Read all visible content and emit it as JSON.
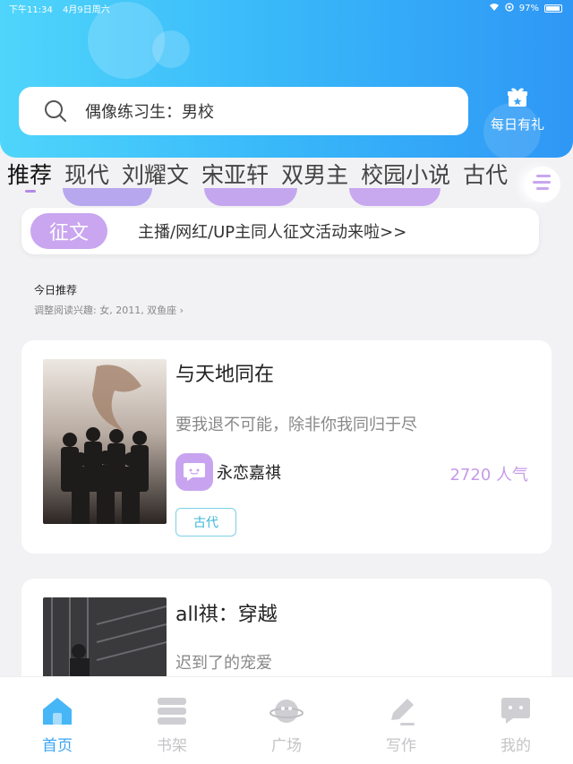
{
  "status_bar": {
    "time": "下午11:34",
    "date": "4月9日周六",
    "battery": "97%"
  },
  "search": {
    "placeholder": "偶像练习生：男校"
  },
  "gift": {
    "label": "每日有礼"
  },
  "tabs": [
    "推荐",
    "现代",
    "刘耀文",
    "宋亚轩",
    "双男主",
    "校园小说",
    "古代"
  ],
  "active_tab": "推荐",
  "notice": {
    "badge": "征文",
    "text": "主播/网红/UP主同人征文活动来啦>>"
  },
  "section": {
    "title": "今日推荐",
    "subtitle": "调整阅读兴趣: 女, 2011, 双鱼座 ›"
  },
  "books": [
    {
      "title": "与天地同在",
      "desc": "要我退不可能，除非你我同归于尽",
      "author": "永恋嘉祺",
      "popularity": "2720 人气",
      "tag": "古代"
    },
    {
      "title": "all祺：穿越",
      "desc": "迟到了的宠爱"
    }
  ],
  "bottom_nav": [
    {
      "label": "首页",
      "icon": "home-icon",
      "active": true
    },
    {
      "label": "书架",
      "icon": "bookshelf-icon"
    },
    {
      "label": "广场",
      "icon": "planet-icon"
    },
    {
      "label": "写作",
      "icon": "pencil-icon"
    },
    {
      "label": "我的",
      "icon": "chat-bubble-icon"
    }
  ],
  "colors": {
    "header_start": "#4fd5fb",
    "header_end": "#2f97f5",
    "accent_purple": "#c9a6ef",
    "accent_blue": "#3aa4f4"
  }
}
